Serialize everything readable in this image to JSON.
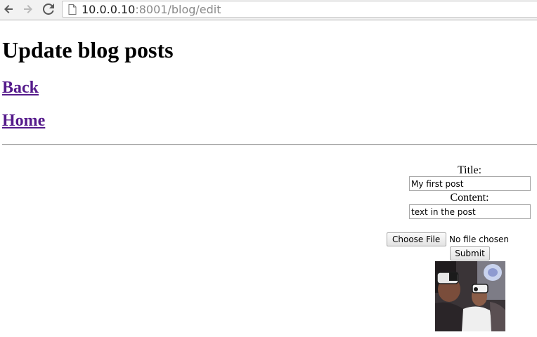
{
  "browser": {
    "url_host": "10.0.0.10",
    "url_rest": ":8001/blog/edit"
  },
  "page": {
    "heading": "Update blog posts",
    "back_link": "Back",
    "home_link": "Home"
  },
  "form": {
    "title_label": "Title:",
    "title_value": "My first post",
    "content_label": "Content:",
    "content_value": "text in the post",
    "choose_file_label": "Choose File",
    "file_status": "No file chosen",
    "submit_label": "Submit"
  },
  "icons": {
    "back": "arrow-left-icon",
    "forward": "arrow-right-icon",
    "reload": "reload-icon",
    "page": "page-icon"
  },
  "colors": {
    "visited_link": "#551a8b",
    "rule": "#9a9a9a"
  }
}
